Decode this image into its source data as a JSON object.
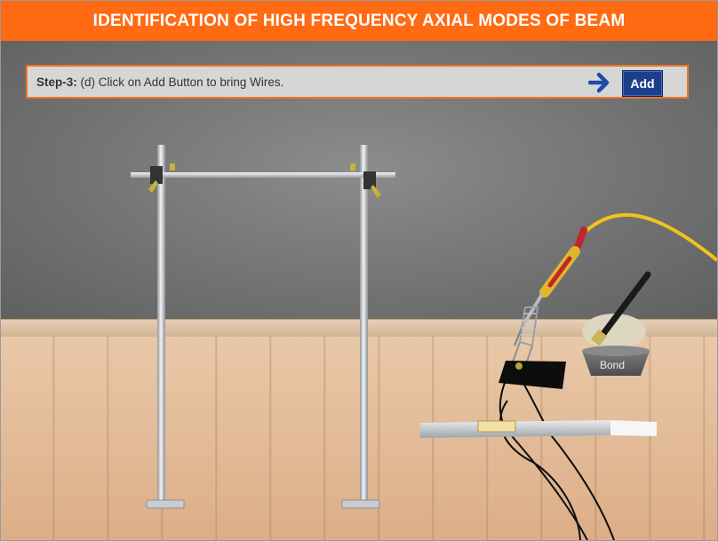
{
  "header": {
    "title": "IDENTIFICATION OF HIGH FREQUENCY AXIAL MODES OF BEAM"
  },
  "instruction": {
    "step_label": "Step-3:",
    "step_text": "(d) Click on Add Button to bring Wires.",
    "add_button_label": "Add",
    "arrow_icon": "arrow-right-icon"
  },
  "scene": {
    "bond_label": "Bond"
  },
  "colors": {
    "header": "#ff6a13",
    "button": "#1c3f8c",
    "arrow": "#1f4aa8",
    "wire": "#f2c21b"
  }
}
